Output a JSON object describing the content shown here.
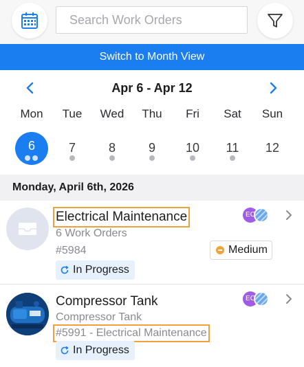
{
  "search": {
    "placeholder": "Search Work Orders"
  },
  "switch_label": "Switch to Month View",
  "week": {
    "range": "Apr 6 - Apr 12",
    "days": [
      "Mon",
      "Tue",
      "Wed",
      "Thu",
      "Fri",
      "Sat",
      "Sun"
    ],
    "dates": [
      "6",
      "7",
      "8",
      "9",
      "10",
      "11",
      "12"
    ],
    "selected_index": 0
  },
  "section_header": "Monday, April 6th, 2026",
  "work_orders": [
    {
      "title": "Electrical Maintenance",
      "subtitle": "6 Work Orders",
      "number": "#5984",
      "priority": "Medium",
      "status": "In Progress",
      "assignee_initials": "EC"
    },
    {
      "title": "Compressor Tank",
      "subtitle": "Compressor Tank",
      "number": "#5991 - Electrical Maintenance",
      "status": "In Progress",
      "assignee_initials": "EC"
    }
  ],
  "colors": {
    "accent": "#1a7df0",
    "priority_medium": "#f2a335",
    "avatar_purple": "#9f5ce6",
    "highlight": "#f0a03a"
  },
  "icons": [
    "calendar-icon",
    "filter-icon",
    "chevron-left-icon",
    "chevron-right-icon",
    "inbox-icon",
    "refresh-icon",
    "chevron-right-icon"
  ]
}
